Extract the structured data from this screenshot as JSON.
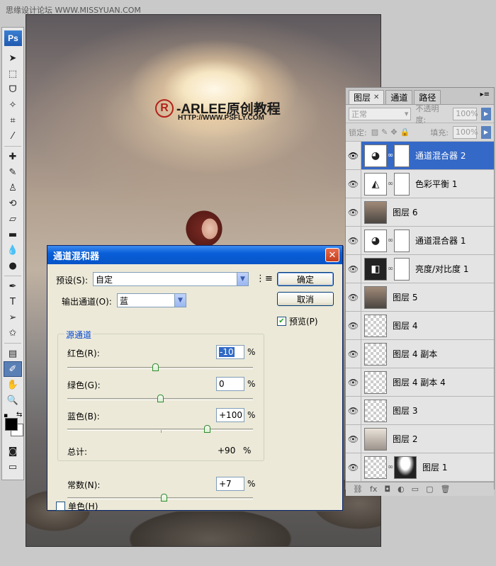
{
  "watermark": "思缘设计论坛  WWW.MISSYUAN.COM",
  "document": {
    "logo_mark": "R",
    "logo_text": "-ARLEE原创教程",
    "logo_url": "HTTP://WWW.PSFLY.COM"
  },
  "toolbar": {
    "app_logo": "Ps",
    "tools": [
      {
        "icon": "move-icon",
        "glyph": "➤"
      },
      {
        "icon": "marquee-icon",
        "glyph": "⬚"
      },
      {
        "icon": "lasso-icon",
        "glyph": "ᗜ"
      },
      {
        "icon": "magic-wand-icon",
        "glyph": "✧"
      },
      {
        "icon": "crop-icon",
        "glyph": "⌗"
      },
      {
        "icon": "eyedropper-icon",
        "glyph": "⁄"
      },
      {
        "icon": "healing-brush-icon",
        "glyph": "✚"
      },
      {
        "icon": "brush-icon",
        "glyph": "✎"
      },
      {
        "icon": "clone-stamp-icon",
        "glyph": "♙"
      },
      {
        "icon": "history-brush-icon",
        "glyph": "⟲"
      },
      {
        "icon": "eraser-icon",
        "glyph": "▱"
      },
      {
        "icon": "gradient-icon",
        "glyph": "▬"
      },
      {
        "icon": "blur-icon",
        "glyph": "💧"
      },
      {
        "icon": "dodge-icon",
        "glyph": "●"
      },
      {
        "icon": "pen-icon",
        "glyph": "✒"
      },
      {
        "icon": "type-icon",
        "glyph": "T"
      },
      {
        "icon": "path-selection-icon",
        "glyph": "➢"
      },
      {
        "icon": "shape-icon",
        "glyph": "✩"
      },
      {
        "icon": "notes-icon",
        "glyph": "▤"
      },
      {
        "icon": "eyedropper-active-icon",
        "glyph": "✐"
      },
      {
        "icon": "hand-icon",
        "glyph": "✋"
      },
      {
        "icon": "zoom-icon",
        "glyph": "🔍"
      }
    ],
    "foreground_color": "#000000",
    "background_color": "#ffffff"
  },
  "layers_panel": {
    "tabs": [
      "图层",
      "通道",
      "路径"
    ],
    "blend_mode": "正常",
    "opacity_label": "不透明度:",
    "opacity_value": "100%",
    "lock_label": "锁定:",
    "fill_label": "填充:",
    "fill_value": "100%",
    "layers": [
      {
        "name": "通道混合器 2",
        "thumb": "mixer",
        "mask": "white",
        "selected": true
      },
      {
        "name": "色彩平衡 1",
        "thumb": "balance",
        "mask": "white",
        "selected": false
      },
      {
        "name": "图层 6",
        "thumb": "photo",
        "mask": "",
        "selected": false
      },
      {
        "name": "通道混合器 1",
        "thumb": "mixer",
        "mask": "white",
        "selected": false
      },
      {
        "name": "亮度/对比度 1",
        "thumb": "contrast",
        "mask": "white",
        "selected": false
      },
      {
        "name": "图层 5",
        "thumb": "photo",
        "mask": "",
        "selected": false
      },
      {
        "name": "图层 4",
        "thumb": "checker",
        "mask": "",
        "selected": false
      },
      {
        "name": "图层 4 副本",
        "thumb": "checker",
        "mask": "",
        "selected": false
      },
      {
        "name": "图层 4 副本 4",
        "thumb": "checker",
        "mask": "",
        "selected": false
      },
      {
        "name": "图层 3",
        "thumb": "checker",
        "mask": "",
        "selected": false
      },
      {
        "name": "图层 2",
        "thumb": "sky",
        "mask": "",
        "selected": false
      },
      {
        "name": "图层 1",
        "thumb": "checker",
        "mask": "dark",
        "selected": false
      }
    ],
    "bottom_icons": [
      "link-icon",
      "fx-icon",
      "mask-icon",
      "adjustment-icon",
      "folder-icon",
      "new-layer-icon",
      "trash-icon"
    ]
  },
  "dialog": {
    "title": "通道混和器",
    "preset_label": "预设(S):",
    "preset_value": "自定",
    "output_label": "输出通道(O):",
    "output_value": "蓝",
    "source_group": "源通道",
    "red_label": "红色(R):",
    "red_value": "-10",
    "green_label": "绿色(G):",
    "green_value": "0",
    "blue_label": "蓝色(B):",
    "blue_value": "+100",
    "total_label": "总计:",
    "total_value": "+90",
    "constant_label": "常数(N):",
    "constant_value": "+7",
    "percent": "%",
    "monochrome_label": "单色(H)",
    "monochrome_checked": false,
    "ok_label": "确定",
    "cancel_label": "取消",
    "preview_label": "预览(P)",
    "preview_checked": true,
    "slider_levels": {
      "red": -10,
      "green": 0,
      "blue": 100,
      "constant": 7
    }
  }
}
